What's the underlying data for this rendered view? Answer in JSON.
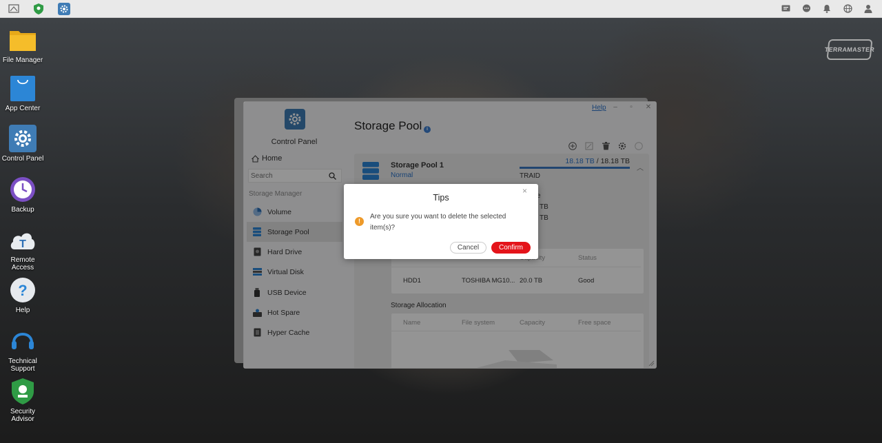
{
  "desktop": {
    "icons": [
      {
        "label": "File Manager"
      },
      {
        "label": "App Center"
      },
      {
        "label": "Control Panel"
      },
      {
        "label": "Backup"
      },
      {
        "label": "Remote Access"
      },
      {
        "label": "Help"
      },
      {
        "label_line1": "Technical",
        "label_line2": "Support"
      },
      {
        "label_line1": "Security",
        "label_line2": "Advisor"
      }
    ],
    "brand": "TERRAMASTER"
  },
  "window": {
    "help_link": "Help",
    "sidebar": {
      "title": "Control Panel",
      "home": "Home",
      "search_placeholder": "Search",
      "section": "Storage Manager",
      "items": [
        {
          "label": "Volume"
        },
        {
          "label": "Storage Pool"
        },
        {
          "label": "Hard Drive"
        },
        {
          "label": "Virtual Disk"
        },
        {
          "label": "USB Device"
        },
        {
          "label": "Hot Spare"
        },
        {
          "label": "Hyper Cache"
        }
      ]
    },
    "main": {
      "title": "Storage Pool",
      "pool": {
        "name": "Storage Pool 1",
        "status": "Normal",
        "capacity_used": "18.18 TB",
        "capacity_sep": " / ",
        "capacity_total": "18.18 TB",
        "raid": "TRAID",
        "frag1": "e",
        "frag2": "TB",
        "frag3": "TB"
      },
      "drives_table": {
        "headers": [
          "Capacity",
          "Status"
        ],
        "row": {
          "name": "HDD1",
          "model": "TOSHIBA MG10...",
          "capacity": "20.0 TB",
          "status": "Good"
        }
      },
      "allocation": {
        "title": "Storage Allocation",
        "headers": [
          "Name",
          "File system",
          "Capacity",
          "Free space"
        ]
      }
    }
  },
  "dialog": {
    "title": "Tips",
    "message": "Are you sure you want to delete the selected item(s)?",
    "cancel": "Cancel",
    "confirm": "Confirm"
  },
  "colors": {
    "accent_blue": "#2b73c8",
    "confirm_red": "#e4141a",
    "warning_orange": "#ee9a2a"
  }
}
